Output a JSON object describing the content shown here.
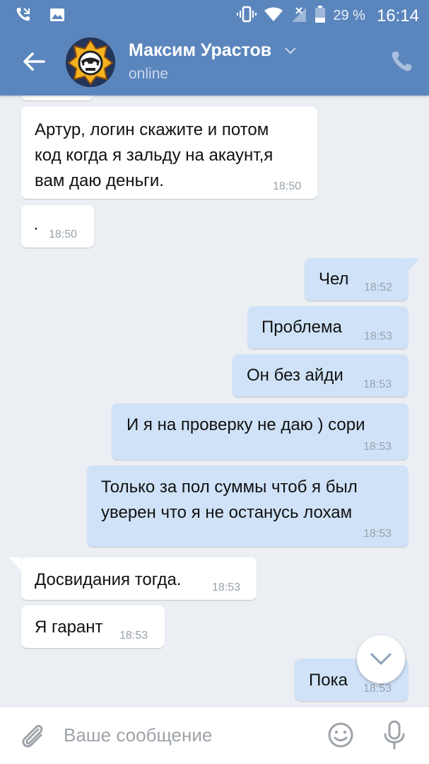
{
  "status_bar": {
    "battery": "29 %",
    "time": "16:14",
    "icons": [
      "missed-call-icon",
      "gallery-icon",
      "vibrate-icon",
      "wifi-icon",
      "signal-icon",
      "battery-icon"
    ]
  },
  "header": {
    "contact_name": "Максим Урастов",
    "contact_status": "online",
    "icons": [
      "back-arrow-icon",
      "chevron-down-icon",
      "phone-icon"
    ]
  },
  "messages": [
    {
      "direction": "in",
      "text_lines": [
        "Артур, логин скажите и потом",
        "код когда я зальду на акаунт,я",
        "вам даю деньги."
      ],
      "time": "18:50"
    },
    {
      "direction": "in",
      "text_lines": [
        "·"
      ],
      "time": "18:50"
    },
    {
      "direction": "out",
      "text_lines": [
        "Чел"
      ],
      "time": "18:52"
    },
    {
      "direction": "out",
      "text_lines": [
        "Проблема"
      ],
      "time": "18:53"
    },
    {
      "direction": "out",
      "text_lines": [
        "Он без айди"
      ],
      "time": "18:53"
    },
    {
      "direction": "out",
      "text_lines": [
        "И я на проверку не даю ) сори"
      ],
      "time": "18:53"
    },
    {
      "direction": "out",
      "text_lines": [
        "Только за пол суммы чтоб я был",
        "уверен что я не останусь лохам"
      ],
      "time": "18:53"
    },
    {
      "direction": "in",
      "text_lines": [
        "Досвидания тогда."
      ],
      "time": "18:53"
    },
    {
      "direction": "in",
      "text_lines": [
        "Я гарант"
      ],
      "time": "18:53"
    },
    {
      "direction": "out",
      "text_lines": [
        "Пока"
      ],
      "time": "18:53"
    }
  ],
  "composer": {
    "placeholder": "Ваше сообщение",
    "icons": [
      "paperclip-icon",
      "emoji-icon",
      "microphone-icon"
    ]
  },
  "colors": {
    "header": "#5b86bd",
    "chat_background": "#ebeff4",
    "incoming_bubble": "#ffffff",
    "outgoing_bubble": "#cfe2f7"
  }
}
